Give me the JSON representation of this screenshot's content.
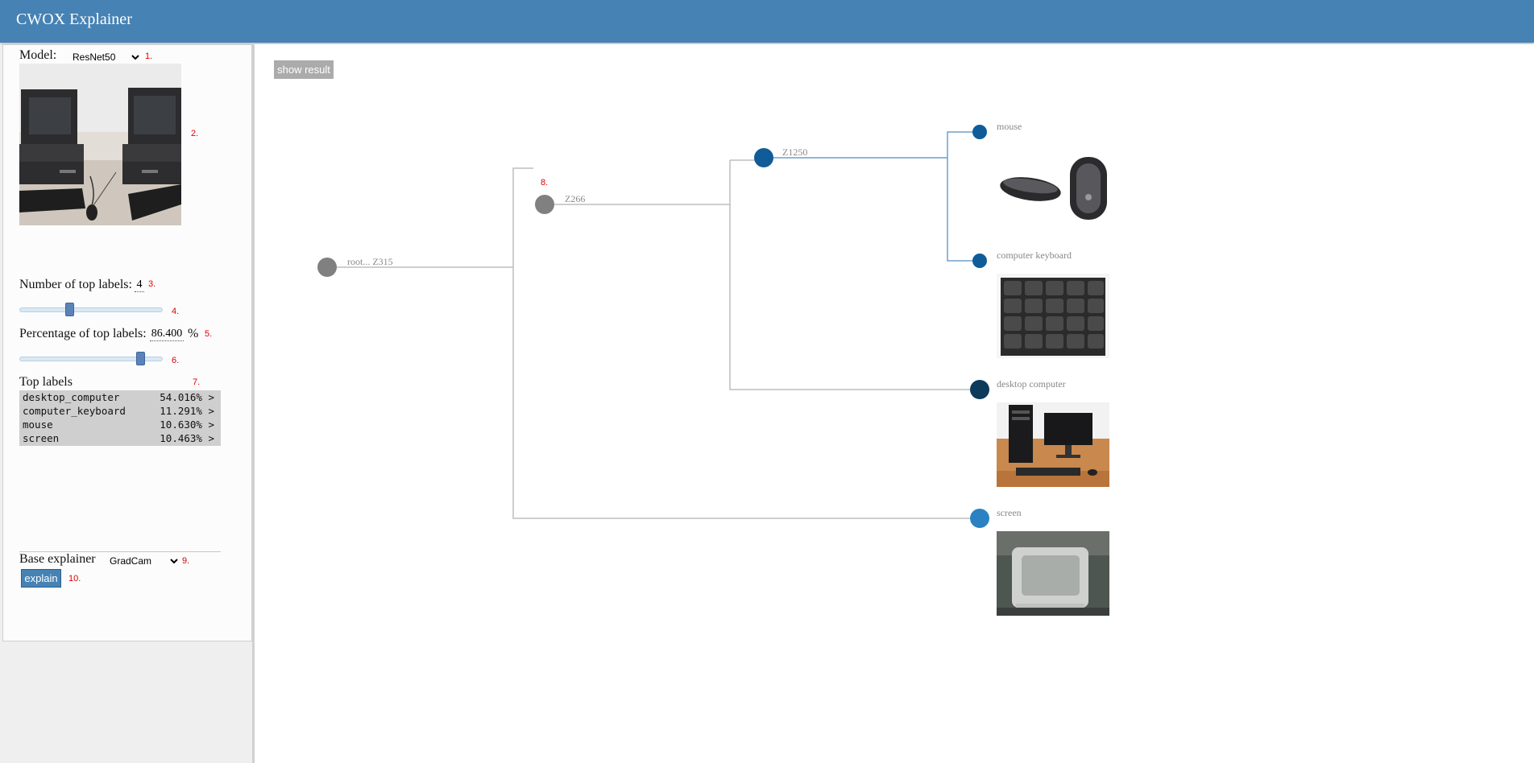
{
  "app": {
    "title": "CWOX Explainer"
  },
  "sidebar": {
    "model_label": "Model:",
    "model_selected": "ResNet50",
    "model_options": [
      "ResNet50"
    ],
    "num_top_label": "Number of top labels:",
    "num_top_value": "4",
    "num_top_slider": 0.35,
    "pct_top_label": "Percentage of top labels:",
    "pct_top_value": "86.400",
    "pct_unit": "%",
    "pct_top_slider": 0.85,
    "top_labels_title": "Top labels",
    "top_labels": [
      {
        "name": "desktop_computer",
        "pct": "54.016% >"
      },
      {
        "name": "computer_keyboard",
        "pct": "11.291% >"
      },
      {
        "name": "mouse",
        "pct": "10.630% >"
      },
      {
        "name": "screen",
        "pct": "10.463% >"
      }
    ],
    "base_explainer_label": "Base explainer",
    "base_explainer_selected": "GradCam",
    "base_explainer_options": [
      "GradCam"
    ],
    "explain_button": "explain",
    "step_markers": [
      "1.",
      "2.",
      "3.",
      "4.",
      "5.",
      "6.",
      "7.",
      "9.",
      "10."
    ]
  },
  "main": {
    "show_result_button": "show result",
    "tree_marker": "8.",
    "tree": {
      "root": "root... Z315",
      "n1": "Z266",
      "n2": "Z1250",
      "leaves": [
        "mouse",
        "computer keyboard",
        "desktop computer",
        "screen"
      ]
    }
  },
  "colors": {
    "header": "#4682b4",
    "node_gray": "#808080",
    "node_blue": "#0f5c99",
    "node_dark": "#0b3a5a",
    "node_light": "#2b82c2",
    "edge_gray": "#bdbdbd",
    "edge_blue": "#6f9fcb"
  }
}
